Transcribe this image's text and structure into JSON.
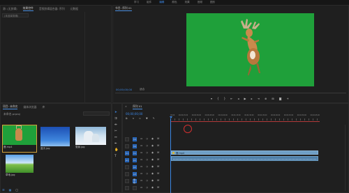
{
  "menubar": {
    "items": [
      "学习",
      "组件",
      "编辑",
      "颜色",
      "效果",
      "音频",
      "图形"
    ],
    "active_index": 2
  },
  "source_panel": {
    "tabs": [
      {
        "label": "源: (无剪辑)",
        "selected": false
      },
      {
        "label": "效果控件",
        "selected": true
      },
      {
        "label": "音频剪辑混合器: 序列",
        "selected": false
      },
      {
        "label": "元数据",
        "selected": false
      }
    ],
    "dropdown": "(未选择剪辑)"
  },
  "program_monitor": {
    "title": "节目: 序列 01",
    "timecode": "00;00;00;00",
    "fit_label": "适合",
    "transport_icons": [
      "add-marker-icon",
      "mark-in-icon",
      "mark-out-icon",
      "go-to-in-icon",
      "step-back-icon",
      "play-icon",
      "step-forward-icon",
      "go-to-out-icon",
      "insert-icon",
      "overwrite-icon",
      "camera-icon",
      "button-editor-icon"
    ]
  },
  "project_panel": {
    "tabs": [
      {
        "label": "项目: 未命名",
        "selected": true
      },
      {
        "label": "媒体浏览器",
        "selected": false
      },
      {
        "label": "库",
        "selected": false
      }
    ],
    "project_name": "未命名.prproj",
    "thumbnails": [
      {
        "label": "鹿.mp4",
        "kind": "deer"
      },
      {
        "label": "蓝天.jpg",
        "kind": "sky"
      },
      {
        "label": "雪景.jpg",
        "kind": "snow"
      },
      {
        "label": "草地.jpg",
        "kind": "field"
      }
    ]
  },
  "tools": [
    "selection-tool-icon",
    "track-select-tool-icon",
    "ripple-edit-tool-icon",
    "razor-tool-icon",
    "slip-tool-icon",
    "pen-tool-icon",
    "hand-tool-icon",
    "type-tool-icon"
  ],
  "timeline": {
    "title": "序列 01",
    "timecode": "00;00;00;00",
    "ruler_labels": [
      "00;00",
      "00;00;15;00",
      "00;00;30;00",
      "00;00;45;00",
      "00;01;00;00",
      "00;01;15;00",
      "00;01;30;00",
      "00;01;45;00",
      "00;02;00;00",
      "00;02;15;00",
      "00;02;30;00",
      "00;02;45;00"
    ],
    "tracks": [
      {
        "target": "",
        "name": "V3"
      },
      {
        "target": "",
        "name": "V2"
      },
      {
        "target": "V1",
        "name": "V1"
      },
      {
        "target": "A1",
        "name": "A1"
      },
      {
        "target": "",
        "name": "A2"
      },
      {
        "target": "",
        "name": "A3"
      },
      {
        "target": "",
        "name": "混合"
      },
      {
        "target": "",
        "name": ""
      }
    ],
    "video_clip_label": "鹿.mp4"
  },
  "colors": {
    "accent": "#3b86e3",
    "green_screen": "#1fa03a",
    "video_clip": "#6e9ec4",
    "audio_clip": "#4f7fa8",
    "playhead_circle": "#d23030"
  }
}
